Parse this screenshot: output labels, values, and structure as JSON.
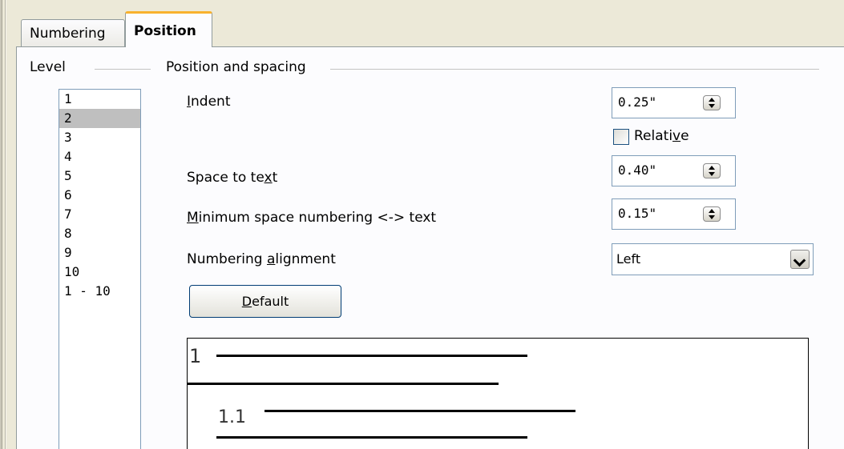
{
  "tabs": {
    "numbering": "Numbering",
    "position": "Position"
  },
  "level": {
    "header": "Level",
    "items": [
      "1",
      "2",
      "3",
      "4",
      "5",
      "6",
      "7",
      "8",
      "9",
      "10",
      "1 - 10"
    ],
    "selected": "2"
  },
  "position_spacing": {
    "header": "Position and spacing",
    "indent": {
      "mnemonic": "I",
      "label_rest": "ndent",
      "value": "0.25\""
    },
    "relative": {
      "pre": "Relati",
      "mnemonic": "v",
      "post": "e",
      "checked": false
    },
    "space_to_text": {
      "pre": "Space to te",
      "mnemonic": "x",
      "post": "t",
      "value": "0.40\""
    },
    "min_space": {
      "mnemonic": "M",
      "label_rest": "inimum space numbering <-> text",
      "value": "0.15\""
    },
    "alignment": {
      "pre": "Numbering ",
      "mnemonic": "a",
      "post": "lignment",
      "value": "Left"
    },
    "default_button": {
      "mnemonic": "D",
      "label_rest": "efault"
    }
  },
  "preview": {
    "level1_number": "1",
    "level2_number": "1.1"
  },
  "colors": {
    "active_tab_accent": "#f8b12e",
    "selection": "#bfbfbf",
    "dialog_background": "#ece9d8"
  }
}
